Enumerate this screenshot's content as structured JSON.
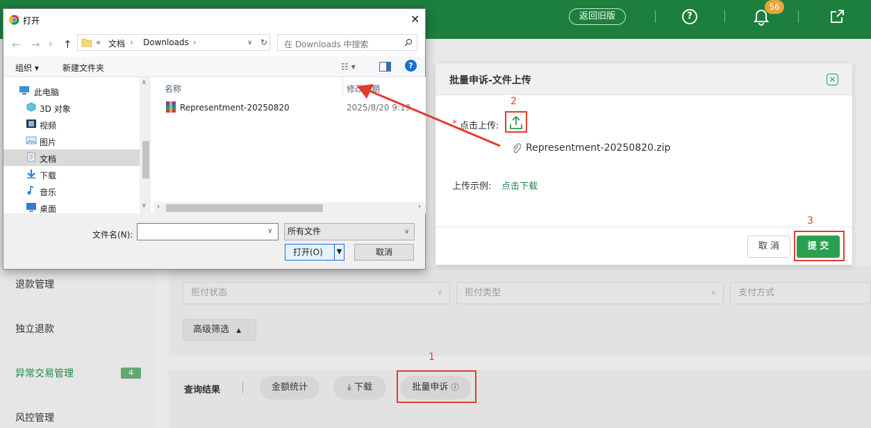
{
  "topbar": {
    "old_version_label": "返回旧版",
    "help_glyph": "?",
    "bell_badge": "56",
    "icons": [
      "help-icon",
      "bell-icon",
      "exit-icon"
    ]
  },
  "sidebar": {
    "items": [
      {
        "label": "退款管理"
      },
      {
        "label": "独立退款"
      },
      {
        "label": "异常交易管理",
        "badge": "4"
      },
      {
        "label": "风控管理"
      }
    ]
  },
  "filters": {
    "refusal_status": "拒付状态",
    "refusal_type": "拒付类型",
    "payment_method": "支付方式",
    "advanced_label": "高级筛选",
    "advanced_arrow": "▲"
  },
  "results": {
    "title": "查询结果",
    "sep": "|",
    "stats_label": "金额统计",
    "download_label": "下载",
    "batch_appeal_label": "批量申诉"
  },
  "modal": {
    "title": "批量申诉-文件上传",
    "close_glyph": "×",
    "required_star": "*",
    "upload_label": "点击上传:",
    "uploaded_file": "Representment-20250820.zip",
    "example_label": "上传示例:",
    "example_link": "点击下载",
    "cancel_label": "取 消",
    "submit_label": "提 交"
  },
  "annotations": {
    "step1": "1",
    "step2": "2",
    "step3": "3",
    "red": "#e23a2e"
  },
  "file_dialog": {
    "title": "打开",
    "close_glyph": "✕",
    "nav_back": "←",
    "nav_forward": "→",
    "nav_down": "∨",
    "nav_up": "↑",
    "path_prefix": "«",
    "path": [
      "文档",
      "Downloads"
    ],
    "path_sep": "›",
    "search_placeholder": "在 Downloads 中搜索",
    "toolbar": {
      "organize": "组织 ▾",
      "new_folder": "新建文件夹",
      "help": "?"
    },
    "tree": [
      {
        "label": "此电脑",
        "icon": "pc-icon"
      },
      {
        "label": "3D 对象",
        "icon": "cube-icon"
      },
      {
        "label": "视频",
        "icon": "video-icon"
      },
      {
        "label": "图片",
        "icon": "picture-icon"
      },
      {
        "label": "文档",
        "icon": "document-icon",
        "selected": true
      },
      {
        "label": "下载",
        "icon": "download-icon"
      },
      {
        "label": "音乐",
        "icon": "music-icon"
      },
      {
        "label": "桌面",
        "icon": "desktop-icon"
      }
    ],
    "columns": {
      "name": "名称",
      "modified": "修改日期"
    },
    "files": [
      {
        "name": "Representment-20250820",
        "modified": "2025/8/20 9:19"
      }
    ],
    "filename_label": "文件名(N):",
    "filetype": "所有文件",
    "open_label": "打开(O)",
    "cancel_label": "取消"
  },
  "colors": {
    "brand_green": "#1c7f3d",
    "submit_green": "#27a14e",
    "link_green": "#1e8a44",
    "badge_orange": "#e8a33a",
    "win_blue": "#1a6fd1"
  }
}
